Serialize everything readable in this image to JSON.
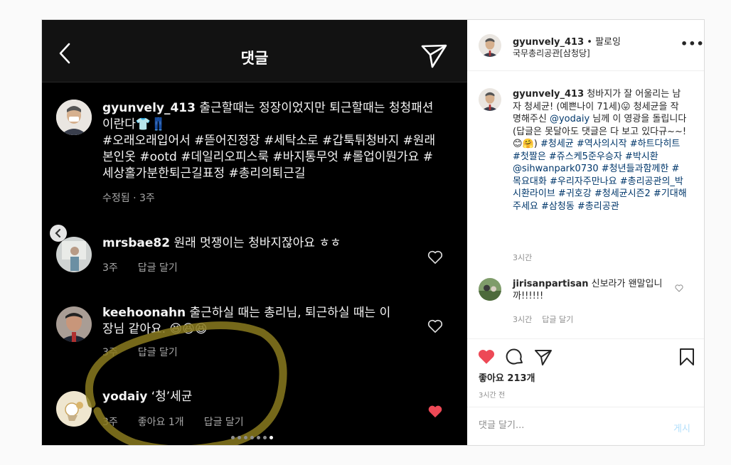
{
  "screenshot": {
    "title": "댓글",
    "comments": [
      {
        "user": "gyunvely_413",
        "text_line1": " 출근할때는 정장이었지만 퇴근할때는 청청패션",
        "text_line2": "이란다",
        "text_emoji": "👕👖",
        "hashtag_lines": [
          "#오래오래입어서 #뜯어진정장 #세탁소로 #갑툭튀청바지 #원래",
          "본인옷 #ootd #데일리오피스룩 #바지통무엇 #롤업이뭔가요 #",
          "세상홀가분한퇴근길표정 #총리의퇴근길"
        ],
        "meta": "수정됨 · 3주"
      },
      {
        "user": "mrsbae82",
        "text": " 원래 멋쟁이는 청바지잖아요 ㅎㅎ",
        "time": "3주",
        "reply": "답글 달기"
      },
      {
        "user": "keehoonahn",
        "text_line1": " 출근하실 때는 총리님, 퇴근하실 때는 이",
        "text_line2": "장님 같아요.",
        "emoji": "😆😆😆",
        "time": "3주",
        "reply": "답글 달기"
      },
      {
        "user": "yodaiy",
        "text": " ‘청’세균",
        "time": "3주",
        "likes": "좋아요 1개",
        "reply": "답글 달기"
      }
    ]
  },
  "panel": {
    "header": {
      "username": "gyunvely_413",
      "separator": " • ",
      "follow_status": "팔로잉",
      "location": "국무총리공관[삼청당]",
      "more": "•••"
    },
    "caption": {
      "username": "gyunvely_413",
      "t1": " 청바지가 잘 어울리는 남자 청세균! (예쁜나이 71세)",
      "e1": "😛",
      "t2": " 청세균을 작명해주신 ",
      "mention1": "@yodaiy",
      "t3": " 님께 이 영광을 돌립니다 (답글은 못달아도 댓글은 다 보고 있다규~~!",
      "e2": "😊🤗",
      "t4": ") ",
      "tags1": "#청세균 #역사의시작 #하트다히트 #첫짤은 #쥬스케5준우승자 #박시환 @sihwanpark0730 #청년들과함께한 #목요대화 #우리자주만나요 #총리공관의_박시환라이브 #귀호강 #청세균시즌2 #기대해주세요 #삼청동 #총리공관",
      "time": "3시간"
    },
    "comment": {
      "username": "jirisanpartisan",
      "text": " 신보라가 왠말입니까!!!!!!",
      "time": "3시간",
      "reply": "답글 달기"
    },
    "likes": "좋아요 213개",
    "posted": "3시간 전",
    "add_comment_placeholder": "댓글 달기...",
    "post_button": "게시"
  },
  "colors": {
    "heart_red": "#ed4956",
    "annotation_gold": "#8a7a1e"
  }
}
